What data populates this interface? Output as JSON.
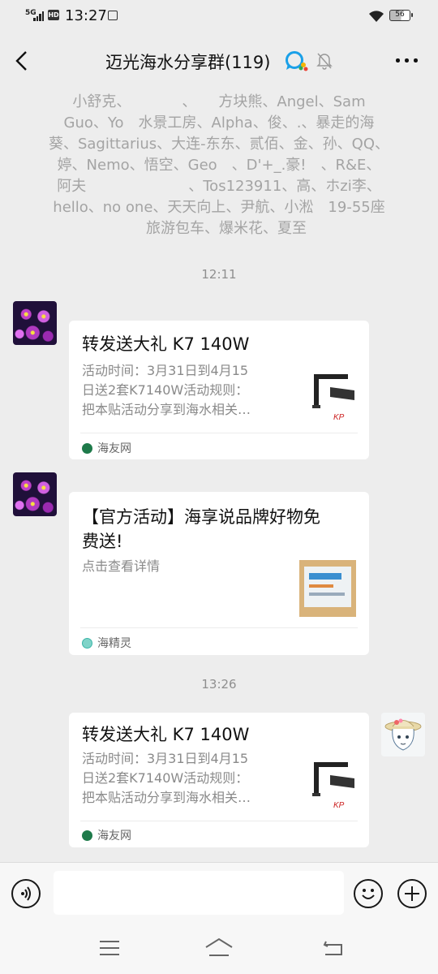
{
  "status_bar": {
    "network": "5G",
    "hd": "HD",
    "time": "13:27",
    "battery": "56"
  },
  "header": {
    "back_icon": "back-arrow-icon",
    "title": "迈光海水分享群(119)",
    "more_icon": "more-dots-icon"
  },
  "system_message": {
    "lines": [
      "小舒克、　　　　、　　方块熊、Angel、Sam",
      "Guo、Yo　水景工房、Alpha、俊、.、暴走的海",
      "葵、Sagittarius、大连-东东、贰佰、金、孙、QQ、",
      "婷、Nemo、悟空、Geo　、D'+_.豪!　、R&E、",
      "阿夫　　　　　　　、Tos123911、高、ホzi李、",
      "hello、no one、天天向上、尹航、小淞　19-55座",
      "　旅游包车、爆米花、夏至"
    ]
  },
  "messages": [
    {
      "time": "12:11",
      "sender": "other",
      "title": "转发送大礼 K7 140W",
      "desc": [
        "活动时间：3月31日到4月15",
        "日送2套K7140W活动规则：",
        "把本贴活动分享到海水相关…"
      ],
      "source": "海友网"
    },
    {
      "sender": "other",
      "title_lines": [
        "【官方活动】海享说品牌好物免",
        "费送!"
      ],
      "desc": [
        "点击查看详情"
      ],
      "source": "海精灵"
    },
    {
      "time": "13:26",
      "sender": "self",
      "title": "转发送大礼 K7 140W",
      "desc": [
        "活动时间：3月31日到4月15",
        "日送2套K7140W活动规则：",
        "把本贴活动分享到海水相关…"
      ],
      "source": "海友网"
    }
  ],
  "input_bar": {
    "placeholder": ""
  }
}
